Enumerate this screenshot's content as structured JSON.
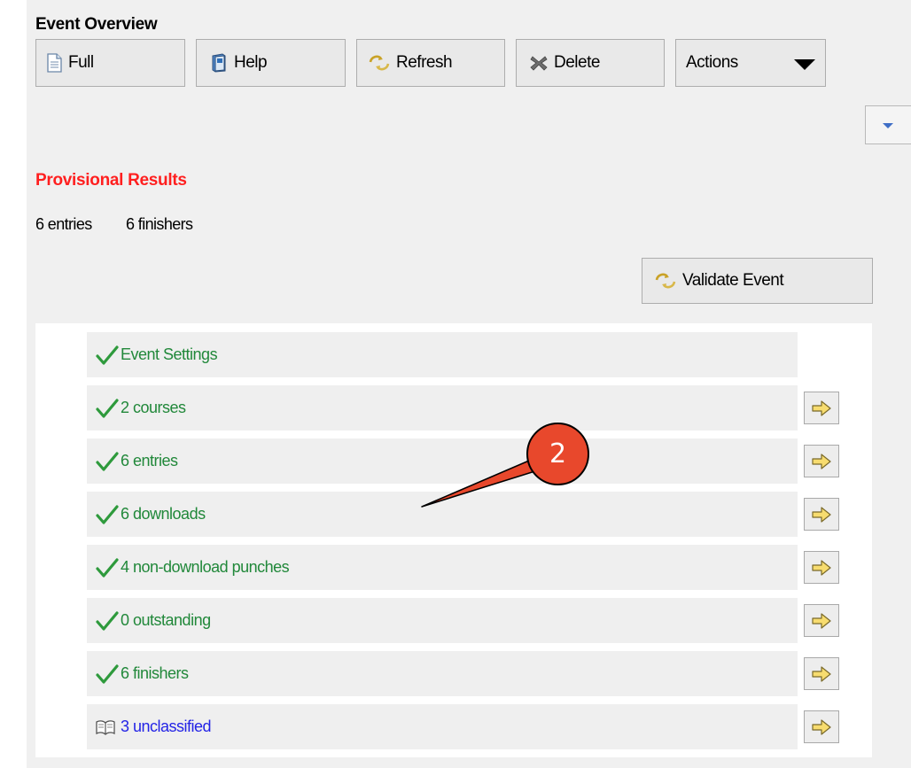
{
  "panel": {
    "title": "Event Overview"
  },
  "toolbar": {
    "full_label": "Full",
    "help_label": "Help",
    "refresh_label": "Refresh",
    "delete_label": "Delete",
    "actions_label": "Actions"
  },
  "status": {
    "label": "Provisional Results",
    "color": "#ff1f1f",
    "entries_count": "6 entries",
    "finishers_count": "6 finishers"
  },
  "validate_button": {
    "label": "Validate Event"
  },
  "checklist": {
    "items": [
      {
        "label": "Event Settings",
        "icon": "green-checkmark-icon",
        "has_arrow": false
      },
      {
        "label": "2 courses",
        "icon": "green-checkmark-icon",
        "has_arrow": true
      },
      {
        "label": "6 entries",
        "icon": "green-checkmark-icon",
        "has_arrow": true
      },
      {
        "label": "6 downloads",
        "icon": "green-checkmark-icon",
        "has_arrow": true
      },
      {
        "label": "4 non-download punches",
        "icon": "green-checkmark-icon",
        "has_arrow": true
      },
      {
        "label": "0 outstanding",
        "icon": "green-checkmark-icon",
        "has_arrow": true
      },
      {
        "label": "6 finishers",
        "icon": "green-checkmark-icon",
        "has_arrow": true
      },
      {
        "label": "3 unclassified",
        "icon": "open-book-icon",
        "has_arrow": true
      }
    ]
  },
  "annotation": {
    "badge_number": "2"
  },
  "colors": {
    "ok_text": "#21883a",
    "link_text": "#2424e6",
    "badge_fill": "#e8482c",
    "arrow_fill": "#f7dc6f"
  }
}
